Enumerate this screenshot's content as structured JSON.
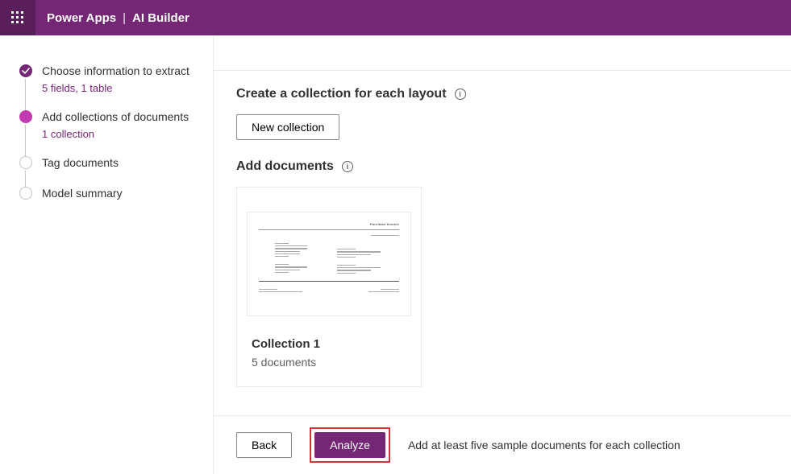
{
  "header": {
    "app_name": "Power Apps",
    "separator": "|",
    "section": "AI Builder"
  },
  "steps": [
    {
      "title": "Choose information to extract",
      "meta": "5 fields, 1 table",
      "state": "completed"
    },
    {
      "title": "Add collections of documents",
      "meta": "1 collection",
      "state": "active"
    },
    {
      "title": "Tag documents",
      "meta": "",
      "state": "pending"
    },
    {
      "title": "Model summary",
      "meta": "",
      "state": "pending"
    }
  ],
  "main": {
    "create_collection_heading": "Create a collection for each layout",
    "new_collection_button": "New collection",
    "add_documents_heading": "Add documents",
    "collection": {
      "preview_title": "Purchase Invoice",
      "name": "Collection 1",
      "doc_count": "5 documents"
    }
  },
  "footer": {
    "back_label": "Back",
    "analyze_label": "Analyze",
    "hint": "Add at least five sample documents for each collection"
  }
}
